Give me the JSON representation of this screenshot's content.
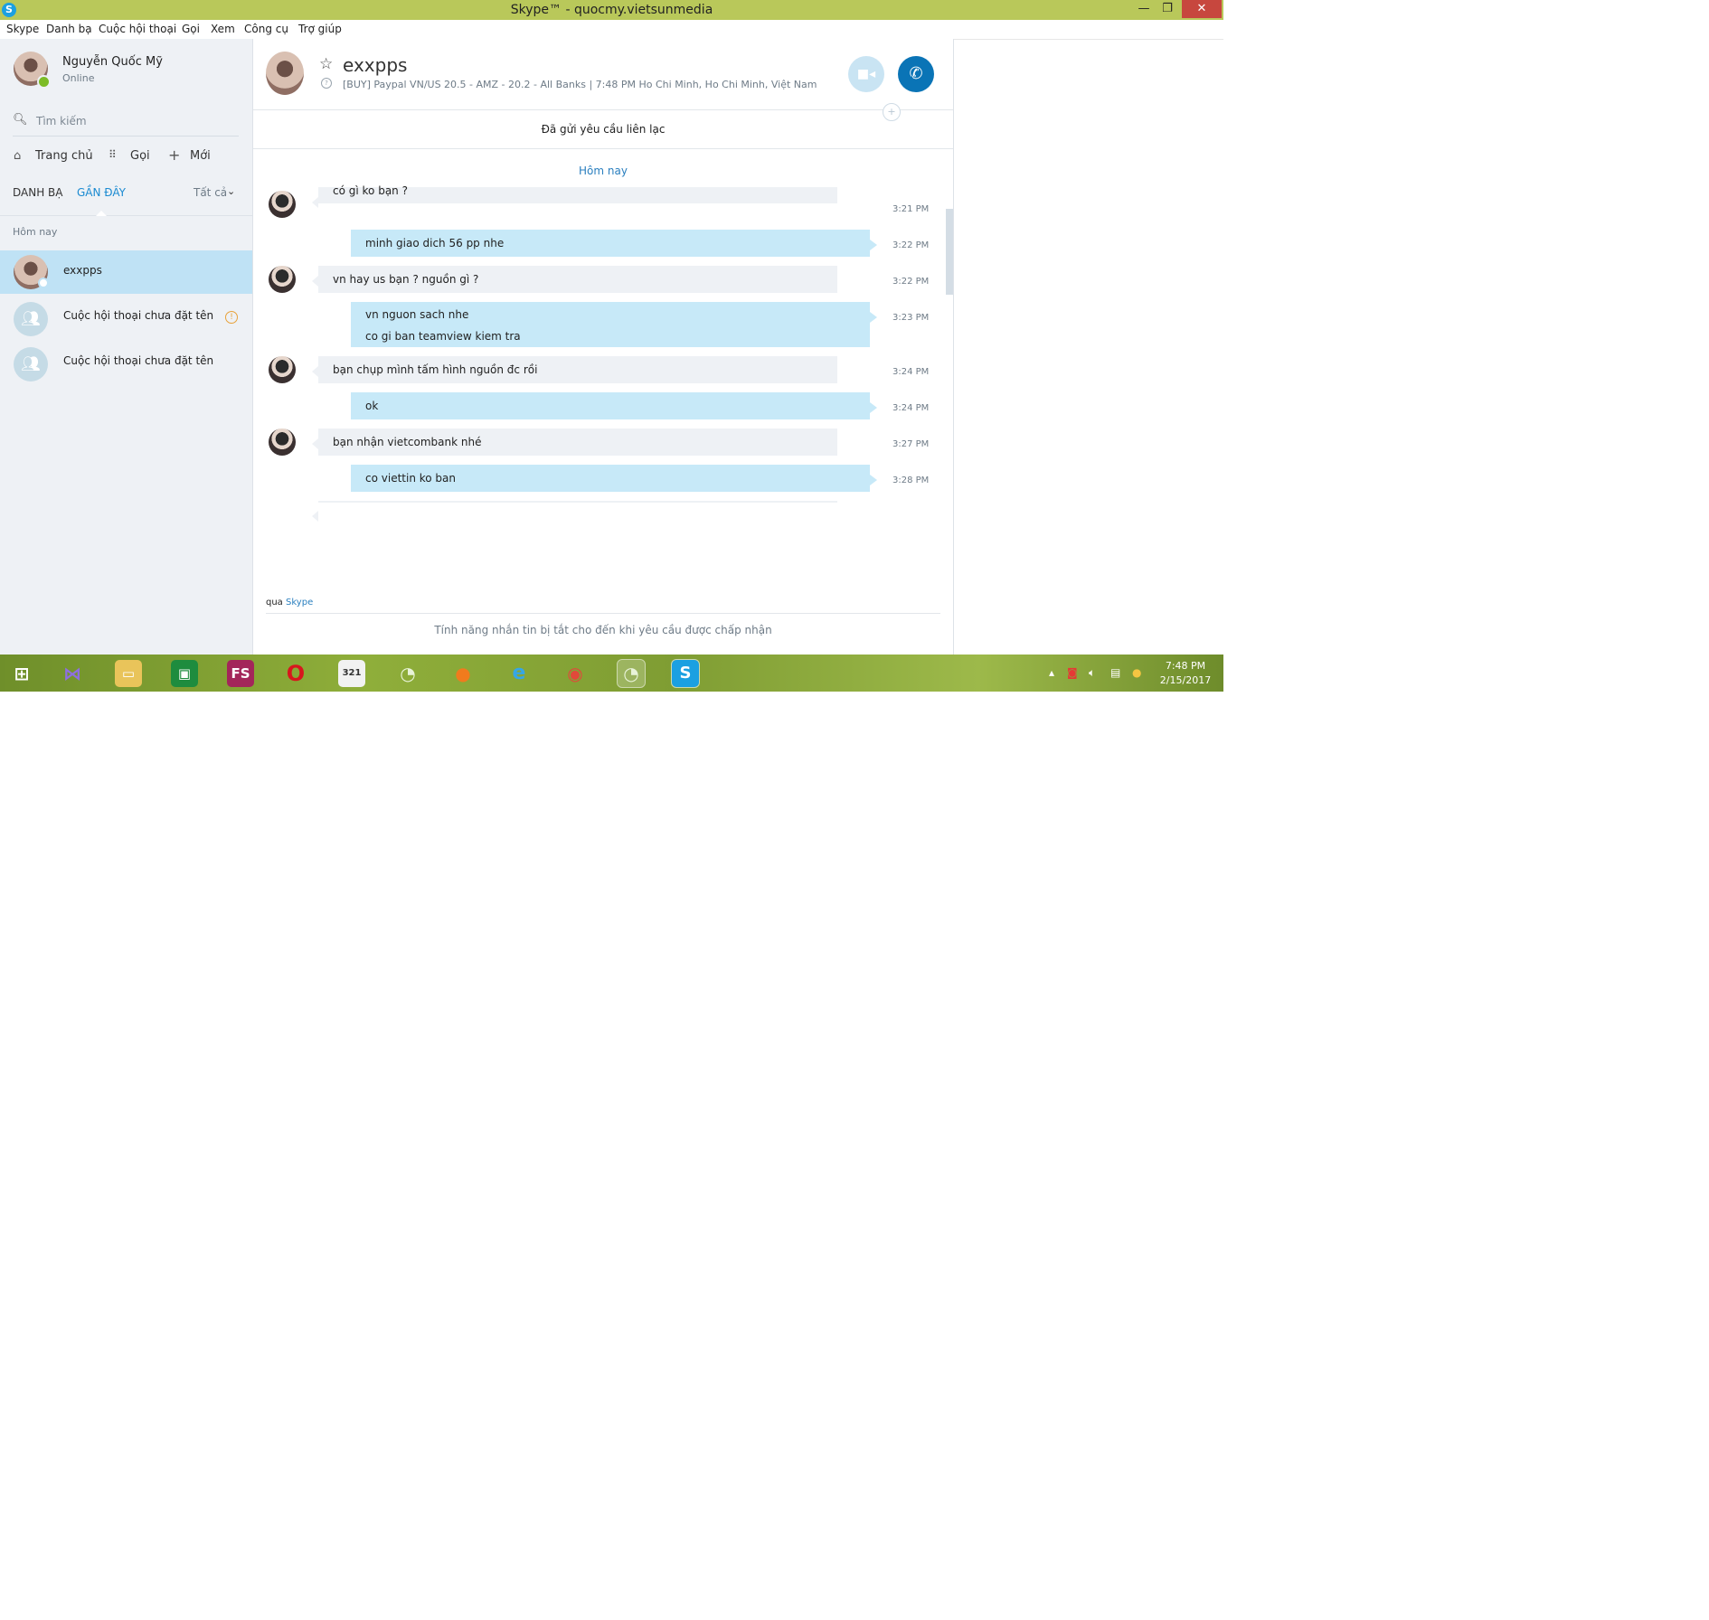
{
  "window": {
    "title": "Skype™ - quocmy.vietsunmedia",
    "app_icon": "S",
    "minimize": "—",
    "restore": "❐",
    "close": "✕"
  },
  "menu": [
    "Skype",
    "Danh bạ",
    "Cuộc hội thoại",
    "Gọi",
    "Xem",
    "Công cụ",
    "Trợ giúp"
  ],
  "profile": {
    "name": "Nguyễn Quốc Mỹ",
    "status": "Online"
  },
  "search": {
    "placeholder": "Tìm kiếm",
    "icon": "search-icon"
  },
  "nav": {
    "home": "Trang chủ",
    "call": "Gọi",
    "new": "Mới"
  },
  "tabs": {
    "contacts": "DANH BẠ",
    "recent": "GẦN ĐÂY",
    "filter": "Tất cả"
  },
  "recent_section": "Hôm nay",
  "conversations": [
    {
      "label": "exxpps",
      "selected": true
    },
    {
      "label": "Cuộc hội thoại chưa đặt tên",
      "warning": true
    },
    {
      "label": "Cuộc hội thoại chưa đặt tên"
    }
  ],
  "chat": {
    "contact_name": "exxpps",
    "mood": "[BUY] Paypal VN/US 20.5 - AMZ - 20.2 - All Banks  |  7:48 PM Ho Chi Minh, Ho Chi Minh, Việt Nam",
    "request_notice": "Đã gửi yêu cầu liên lạc",
    "date_separator": "Hôm nay",
    "via_prefix": "qua",
    "via_brand": "Skype",
    "disabled_note": "Tính năng nhắn tin bị tắt cho đến khi yêu cầu được chấp nhận"
  },
  "messages": [
    {
      "dir": "in",
      "lines": [
        "có gì ko bạn ?"
      ],
      "time": "3:21 PM"
    },
    {
      "dir": "out",
      "lines": [
        "minh giao dich 56 pp nhe"
      ],
      "time": "3:22 PM"
    },
    {
      "dir": "in",
      "lines": [
        "vn hay us bạn ? nguồn gì ?"
      ],
      "time": "3:22 PM"
    },
    {
      "dir": "out",
      "lines": [
        "vn nguon sach nhe",
        "co gi ban teamview kiem tra"
      ],
      "time": "3:23 PM"
    },
    {
      "dir": "in",
      "lines": [
        "bạn chụp mình tấm hình nguồn đc rồi"
      ],
      "time": "3:24 PM"
    },
    {
      "dir": "out",
      "lines": [
        "ok"
      ],
      "time": "3:24 PM"
    },
    {
      "dir": "in",
      "lines": [
        "bạn nhận vietcombank nhé"
      ],
      "time": "3:27 PM"
    },
    {
      "dir": "out",
      "lines": [
        "co viettin ko ban"
      ],
      "time": "3:28 PM"
    }
  ],
  "taskbar": {
    "clock_time": "7:48 PM",
    "clock_date": "2/15/2017",
    "fs_label": "FS",
    "calendar_label": "321",
    "skype_label": "S"
  },
  "colors": {
    "titlebar": "#b9c85a",
    "selected_contact": "#bfe2f5",
    "outgoing_bubble": "#c7e9f8",
    "incoming_bubble": "#eef1f5",
    "call_button": "#0a74b6",
    "link": "#2a7fbf"
  }
}
